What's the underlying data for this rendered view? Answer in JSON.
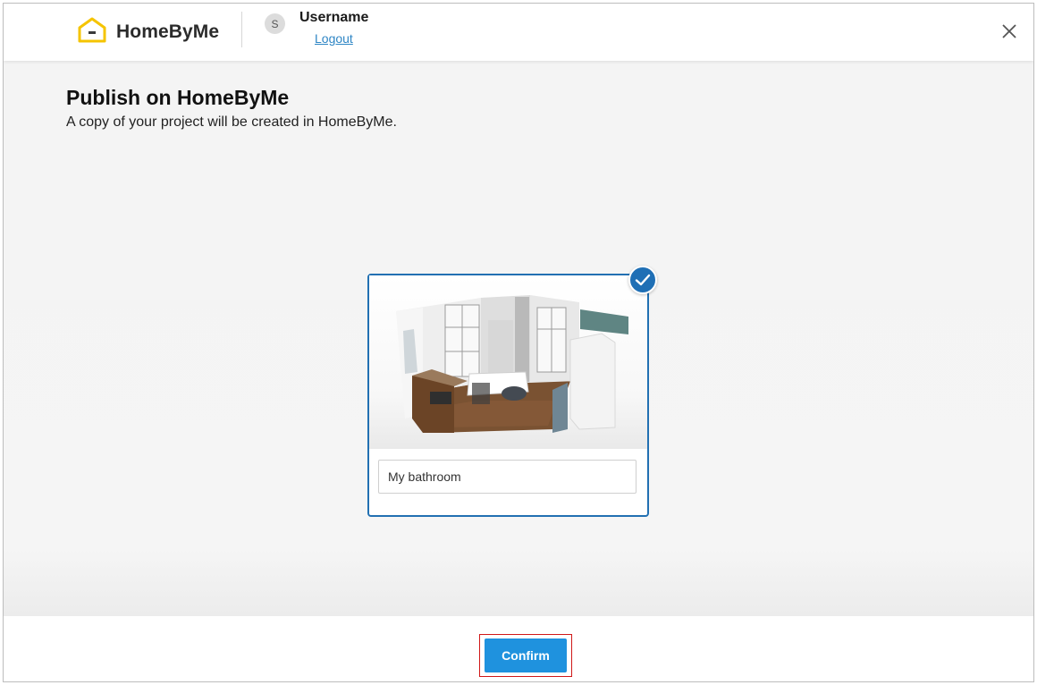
{
  "header": {
    "brand": "HomeByMe",
    "avatar_initial": "S",
    "username": "Username",
    "logout_label": "Logout",
    "logo_icon": "house-logo-icon",
    "close_icon": "close-icon"
  },
  "main": {
    "title": "Publish on HomeByMe",
    "subtitle": "A copy of your project will be created in HomeByMe.",
    "project_card": {
      "selected": true,
      "thumbnail": "bathroom-3d-render",
      "name_value": "My bathroom"
    }
  },
  "footer": {
    "confirm_label": "Confirm"
  },
  "colors": {
    "accent": "#1f92de",
    "card_border": "#2270b2",
    "logo_yellow": "#f5c400",
    "link": "#2f86c5",
    "highlight": "#d01818"
  }
}
